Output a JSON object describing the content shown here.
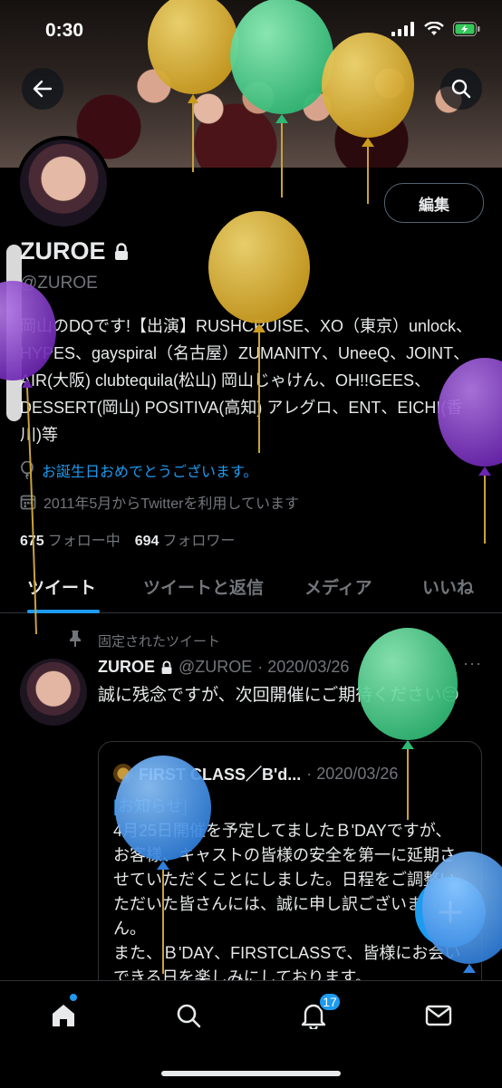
{
  "status_bar": {
    "time": "0:30"
  },
  "profile": {
    "name": "ZUROE",
    "handle": "@ZUROE",
    "edit_label": "編集",
    "bio": "岡山のDQです!【出演】RUSHCRUISE、XO（東京）unlock、HYPES、gayspiral（名古屋）ZUMANITY、UneeQ、JOINT、AIR(大阪) clubtequila(松山) 岡山じゃけん、OH!!GEES、DESSERT(岡山) POSITIVA(高知) アレグロ、ENT、EICHI(香川)等",
    "birthday_text": "お誕生日おめでとうございます。",
    "joined_text": "2011年5月からTwitterを利用しています",
    "following_count": "675",
    "following_label": "フォロー中",
    "followers_count": "694",
    "followers_label": "フォロワー"
  },
  "tabs": [
    {
      "label": "ツイート"
    },
    {
      "label": "ツイートと返信"
    },
    {
      "label": "メディア"
    },
    {
      "label": "いいね"
    }
  ],
  "pinned_tweet": {
    "pinned_label": "固定されたツイート",
    "name": "ZUROE",
    "handle": "@ZUROE",
    "date": "· 2020/03/26",
    "text": "誠に残念ですが、次回開催にご期待ください😔",
    "more": "···",
    "quote": {
      "name": "FIRST CLASS／B'd...",
      "date": "· 2020/03/26",
      "note": "[お知らせ]",
      "text": "4月25日開催を予定してましたＢ'DAYですが、お客様、キャストの皆様の安全を第一に延期させていただくことにしました。日程をご調整いただいた皆さんには、誠に申し訳ございません。\nまた、Ｂ'DAY、FIRSTCLASSで、皆様にお会いできる日を楽しみにしております。"
    }
  },
  "bottom_nav": {
    "notifications_badge": "17"
  },
  "icons": [
    "back-arrow-icon",
    "search-icon",
    "lock-icon",
    "balloon-icon",
    "calendar-icon",
    "pin-icon",
    "plus-icon",
    "home-icon",
    "bell-icon",
    "mail-icon",
    "signal-icon",
    "wifi-icon",
    "battery-icon"
  ],
  "colors": {
    "accent": "#1d9bf0",
    "background": "#000000",
    "text": "#e7e9ea",
    "muted": "#71767b"
  }
}
